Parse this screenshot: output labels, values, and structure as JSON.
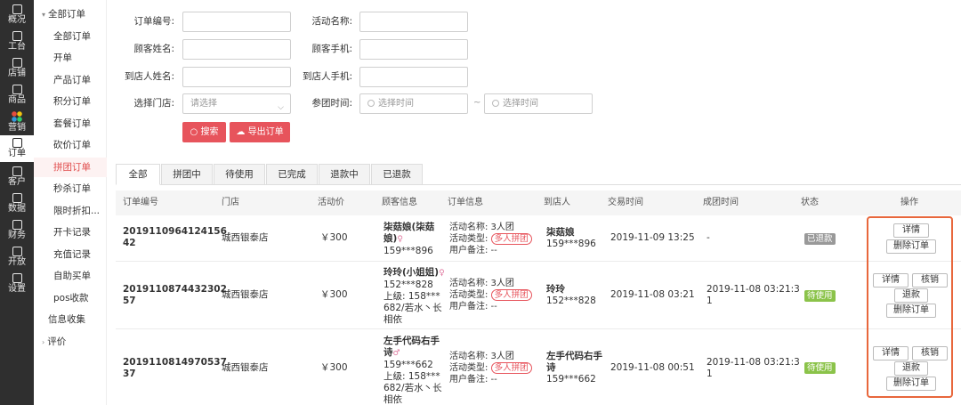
{
  "rail": [
    {
      "label": "概况",
      "icon": "overview-icon"
    },
    {
      "label": "工台",
      "icon": "workbench-icon"
    },
    {
      "label": "店铺",
      "icon": "store-icon"
    },
    {
      "label": "商品",
      "icon": "goods-icon"
    },
    {
      "label": "营销",
      "icon": "marketing-icon"
    },
    {
      "label": "订单",
      "icon": "order-icon",
      "active": true
    },
    {
      "label": "客户",
      "icon": "customer-icon"
    },
    {
      "label": "数据",
      "icon": "data-icon"
    },
    {
      "label": "财务",
      "icon": "finance-icon"
    },
    {
      "label": "开放",
      "icon": "open-icon"
    },
    {
      "label": "设置",
      "icon": "settings-icon"
    }
  ],
  "submenu": {
    "group_all_orders": "全部订单",
    "items": [
      "全部订单",
      "开单",
      "产品订单",
      "积分订单",
      "套餐订单",
      "砍价订单",
      "拼团订单",
      "秒杀订单",
      "限时折扣...",
      "开卡记录",
      "充值记录",
      "自助买单",
      "pos收款",
      "信息收集"
    ],
    "group_review": "评价"
  },
  "filters": {
    "order_no": "订单编号:",
    "activity_name": "活动名称:",
    "customer_name": "顾客姓名:",
    "customer_phone": "顾客手机:",
    "visitor_name": "到店人姓名:",
    "visitor_phone": "到店人手机:",
    "store": "选择门店:",
    "store_placeholder": "请选择",
    "group_time": "参团时间:",
    "time_placeholder": "选择时间",
    "tilde": "~",
    "search_btn": "搜索",
    "export_btn": "导出订单"
  },
  "tabs": [
    "全部",
    "拼团中",
    "待使用",
    "已完成",
    "退款中",
    "已退款"
  ],
  "columns": [
    "订单编号",
    "门店",
    "活动价",
    "顾客信息",
    "订单信息",
    "到店人",
    "交易时间",
    "成团时间",
    "状态",
    "操作"
  ],
  "rows": [
    {
      "order_no_a": "2019110964124156",
      "order_no_b": "42",
      "store": "城西银泰店",
      "price": "￥300",
      "cust_name_a": "柒菇娘(柒菇",
      "cust_name_b": "娘)",
      "cust_sym": "♀",
      "cust_phone": "159***896",
      "info_activity": "活动名称: 3人团",
      "info_type_label": "活动类型:",
      "info_type": "多人拼团",
      "info_note": "用户备注: --",
      "visitor_name": "柒菇娘",
      "visitor_phone": "159***896",
      "trade_time": "2019-11-09 13:25",
      "group_time": "-",
      "status": "已退款",
      "ops": [
        "详情",
        "删除订单"
      ]
    },
    {
      "order_no_a": "2019110874432302",
      "order_no_b": "57",
      "store": "城西银泰店",
      "price": "￥300",
      "cust_name_a": "玲玲(小姐姐)",
      "cust_sym": "♀",
      "cust_phone": "152***828",
      "cust_up_a": "上级: 158***",
      "cust_up_b": "682/若水丶长",
      "cust_up_c": "相依",
      "info_activity": "活动名称: 3人团",
      "info_type_label": "活动类型:",
      "info_type": "多人拼团",
      "info_note": "用户备注: --",
      "visitor_name": "玲玲",
      "visitor_phone": "152***828",
      "trade_time": "2019-11-08 03:21",
      "group_time_a": "2019-11-08 03:21:3",
      "group_time_b": "1",
      "status": "待使用",
      "ops": [
        "详情",
        "核销",
        "退款",
        "删除订单"
      ]
    },
    {
      "order_no_a": "2019110814970537",
      "order_no_b": "37",
      "store": "城西银泰店",
      "price": "￥300",
      "cust_name_a": "左手代码右手",
      "cust_name_b": "诗",
      "cust_sym": "♂",
      "cust_phone": "159***662",
      "cust_up_a": "上级: 158***",
      "cust_up_b": "682/若水丶长",
      "cust_up_c": "相依",
      "info_activity": "活动名称: 3人团",
      "info_type_label": "活动类型:",
      "info_type": "多人拼团",
      "info_note": "用户备注: --",
      "visitor_name_a": "左手代码右手",
      "visitor_name_b": "诗",
      "visitor_phone": "159***662",
      "trade_time": "2019-11-08 00:51",
      "group_time_a": "2019-11-08 03:21:3",
      "group_time_b": "1",
      "status": "待使用",
      "ops": [
        "详情",
        "核销",
        "退款",
        "删除订单"
      ]
    }
  ],
  "colors": {
    "accent": "#e7545c",
    "highlight_outline": "#e8673c",
    "green": "#8bc34a",
    "gray": "#999999",
    "rail": "#2f2f2f"
  }
}
